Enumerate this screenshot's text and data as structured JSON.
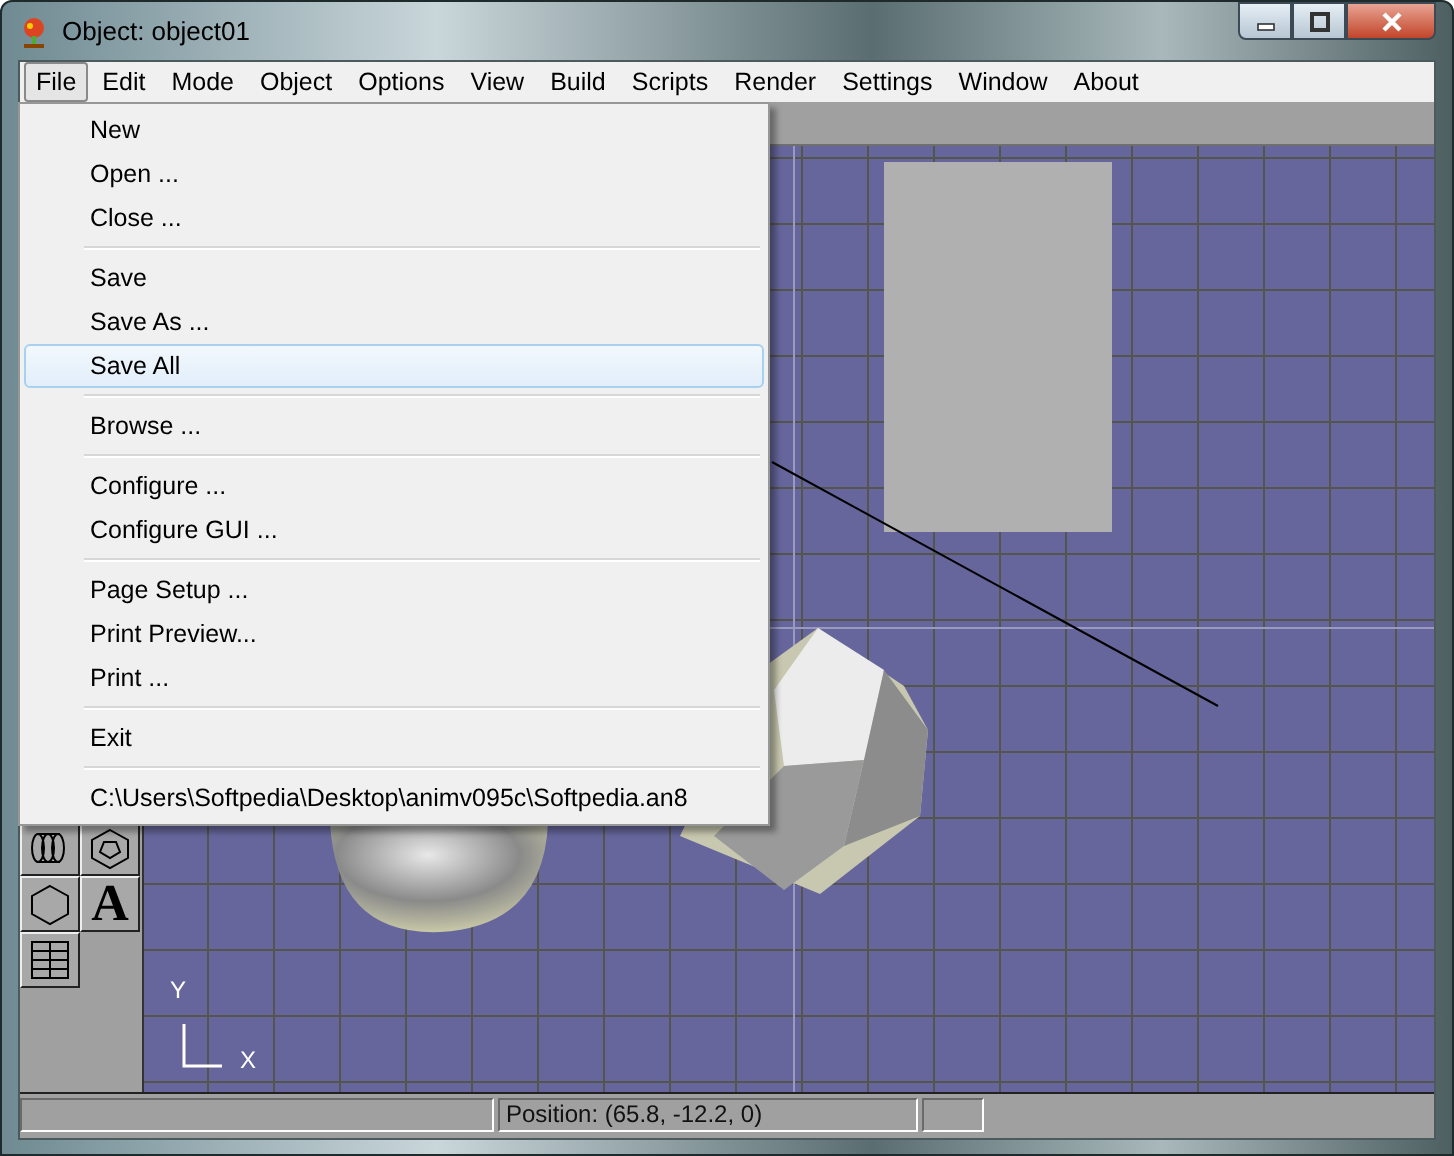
{
  "window": {
    "title": "Object: object01"
  },
  "menu_bar": [
    {
      "label": "File",
      "selected": true
    },
    {
      "label": "Edit",
      "selected": false
    },
    {
      "label": "Mode",
      "selected": false
    },
    {
      "label": "Object",
      "selected": false
    },
    {
      "label": "Options",
      "selected": false
    },
    {
      "label": "View",
      "selected": false
    },
    {
      "label": "Build",
      "selected": false
    },
    {
      "label": "Scripts",
      "selected": false
    },
    {
      "label": "Render",
      "selected": false
    },
    {
      "label": "Settings",
      "selected": false
    },
    {
      "label": "Window",
      "selected": false
    },
    {
      "label": "About",
      "selected": false
    }
  ],
  "file_menu": [
    {
      "items": [
        {
          "label": "New",
          "selected": false
        },
        {
          "label": "Open ...",
          "selected": false
        },
        {
          "label": "Close ...",
          "selected": false
        }
      ]
    },
    {
      "items": [
        {
          "label": "Save",
          "selected": false
        },
        {
          "label": "Save As ...",
          "selected": false
        },
        {
          "label": "Save All",
          "selected": true
        }
      ]
    },
    {
      "items": [
        {
          "label": "Browse ...",
          "selected": false
        }
      ]
    },
    {
      "items": [
        {
          "label": "Configure ...",
          "selected": false
        },
        {
          "label": "Configure GUI ...",
          "selected": false
        }
      ]
    },
    {
      "items": [
        {
          "label": "Page Setup ...",
          "selected": false
        },
        {
          "label": "Print Preview...",
          "selected": false
        },
        {
          "label": "Print ...",
          "selected": false
        }
      ]
    },
    {
      "items": [
        {
          "label": "Exit",
          "selected": false
        }
      ]
    },
    {
      "items": [
        {
          "label": "C:\\Users\\Softpedia\\Desktop\\animv095c\\Softpedia.an8",
          "selected": false
        }
      ]
    }
  ],
  "toolbox": {
    "text_tool": "A"
  },
  "viewport": {
    "axis_y": "Y",
    "axis_x": "X"
  },
  "status_bar": {
    "position": "Position: (65.8, -12.2, 0)"
  }
}
